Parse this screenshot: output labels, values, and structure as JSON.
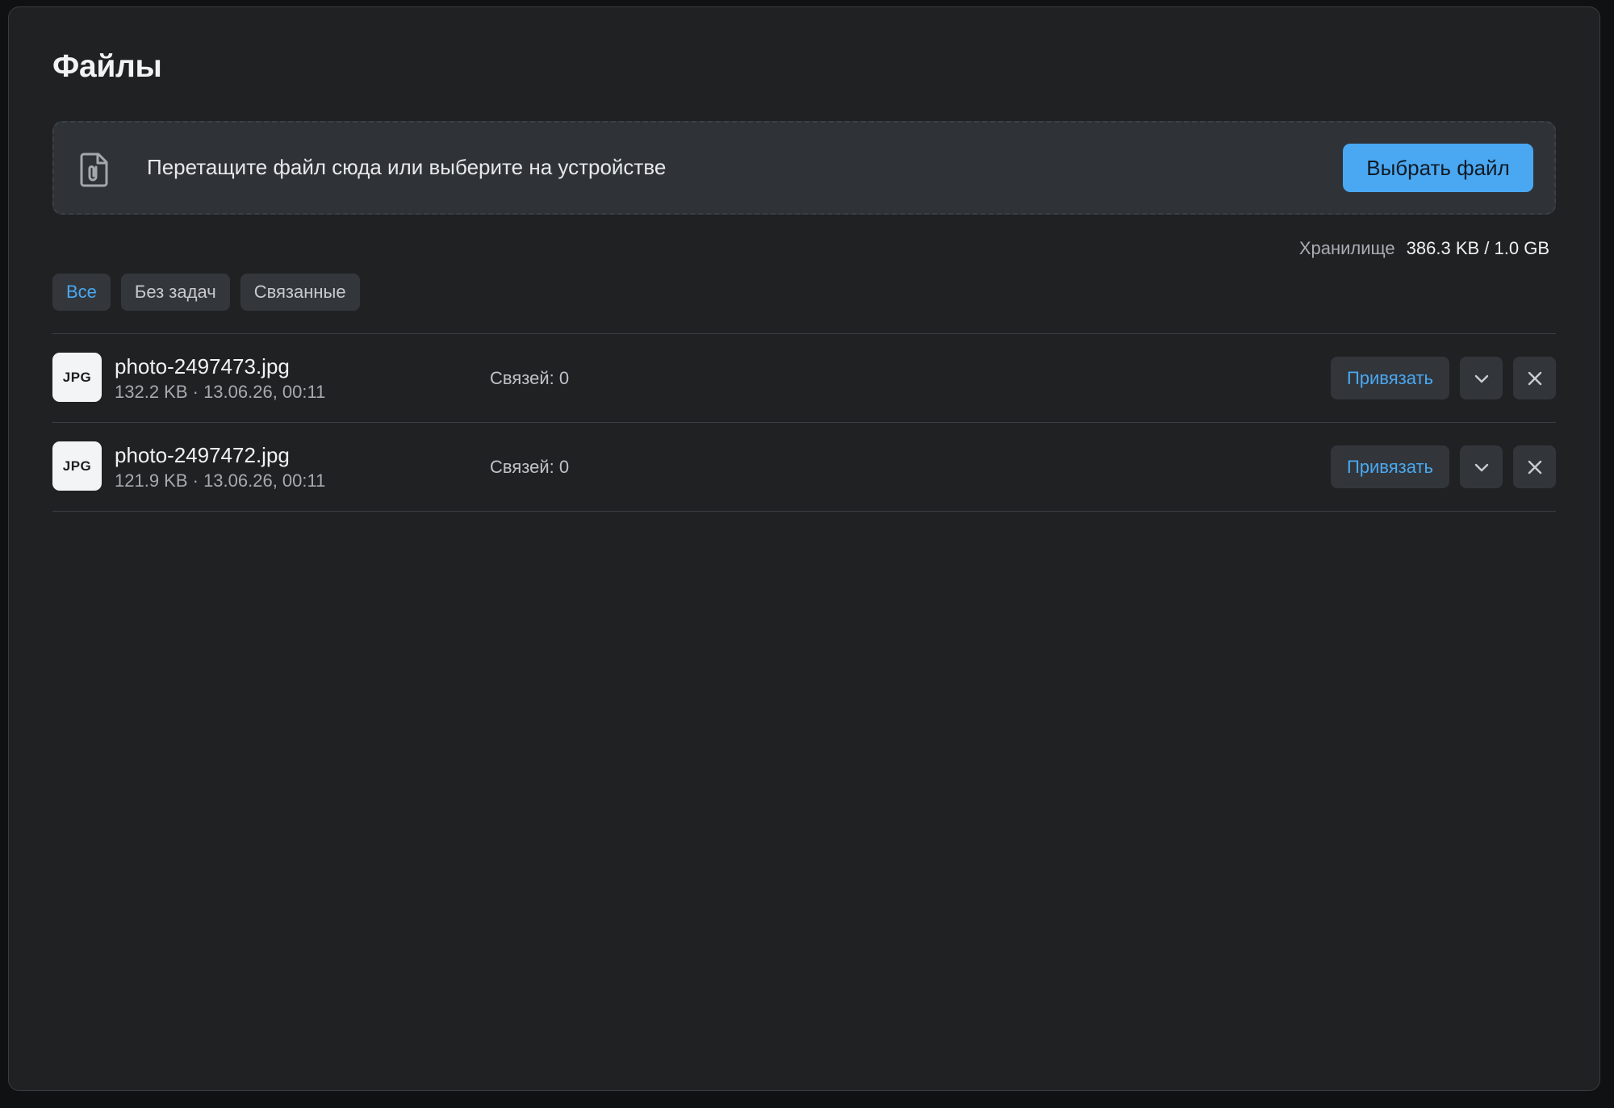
{
  "page": {
    "title": "Файлы"
  },
  "dropzone": {
    "icon": "paperclip-file-icon",
    "text": "Перетащите файл сюда или выберите на устройстве",
    "button_label": "Выбрать файл"
  },
  "storage": {
    "label": "Хранилище",
    "value": "386.3 KB / 1.0 GB"
  },
  "filters": [
    {
      "label": "Все",
      "active": true
    },
    {
      "label": "Без задач",
      "active": false
    },
    {
      "label": "Связанные",
      "active": false
    }
  ],
  "files": [
    {
      "type": "JPG",
      "name": "photo-2497473.jpg",
      "meta": "132.2 KB · 13.06.26, 00:11",
      "links": "Связей: 0",
      "attach_label": "Привязать"
    },
    {
      "type": "JPG",
      "name": "photo-2497472.jpg",
      "meta": "121.9 KB · 13.06.26, 00:11",
      "links": "Связей: 0",
      "attach_label": "Привязать"
    }
  ],
  "colors": {
    "accent": "#4aa8f2",
    "background": "#202123",
    "dropzone": "#2f3338"
  }
}
